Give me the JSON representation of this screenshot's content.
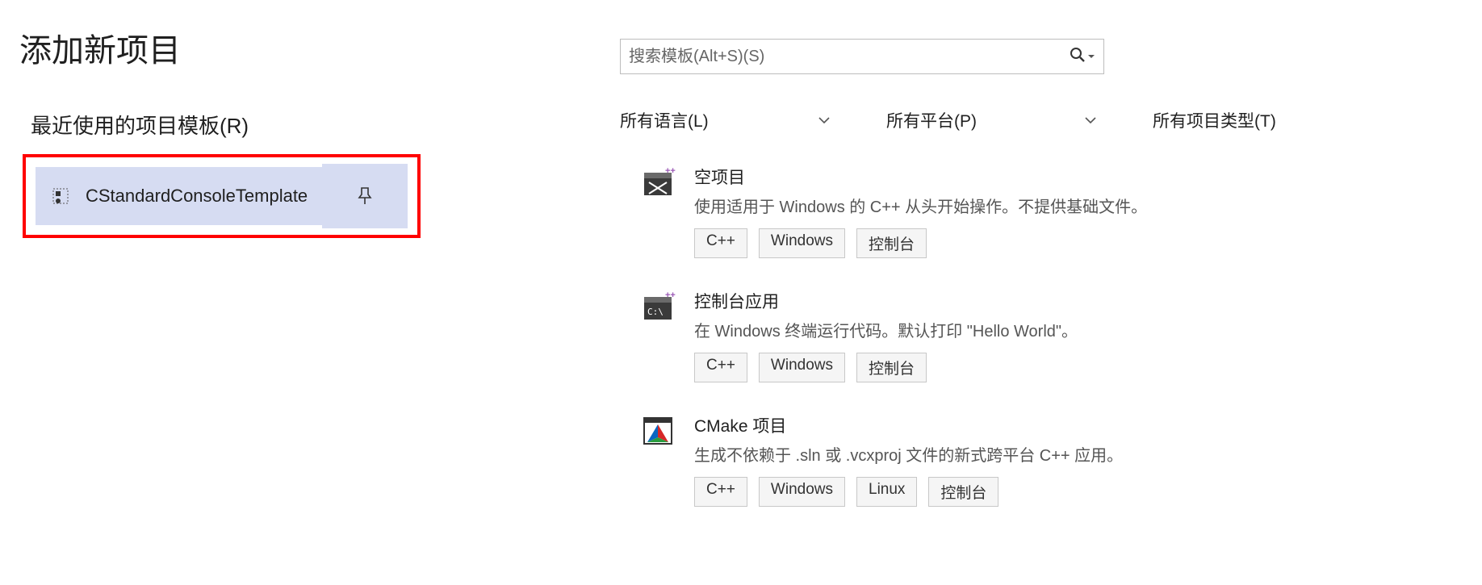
{
  "page": {
    "title": "添加新项目"
  },
  "recent": {
    "section_label": "最近使用的项目模板(R)",
    "item_label": "CStandardConsoleTemplate"
  },
  "search": {
    "placeholder": "搜索模板(Alt+S)(S)"
  },
  "filters": {
    "language": "所有语言(L)",
    "platform": "所有平台(P)",
    "project_type": "所有项目类型(T)"
  },
  "templates": [
    {
      "title": "空项目",
      "desc": "使用适用于 Windows 的 C++ 从头开始操作。不提供基础文件。",
      "tags": [
        "C++",
        "Windows",
        "控制台"
      ],
      "icon": "empty"
    },
    {
      "title": "控制台应用",
      "desc": "在 Windows 终端运行代码。默认打印 \"Hello World\"。",
      "tags": [
        "C++",
        "Windows",
        "控制台"
      ],
      "icon": "console"
    },
    {
      "title": "CMake 项目",
      "desc": "生成不依赖于 .sln 或 .vcxproj 文件的新式跨平台 C++ 应用。",
      "tags": [
        "C++",
        "Windows",
        "Linux",
        "控制台"
      ],
      "icon": "cmake"
    }
  ]
}
